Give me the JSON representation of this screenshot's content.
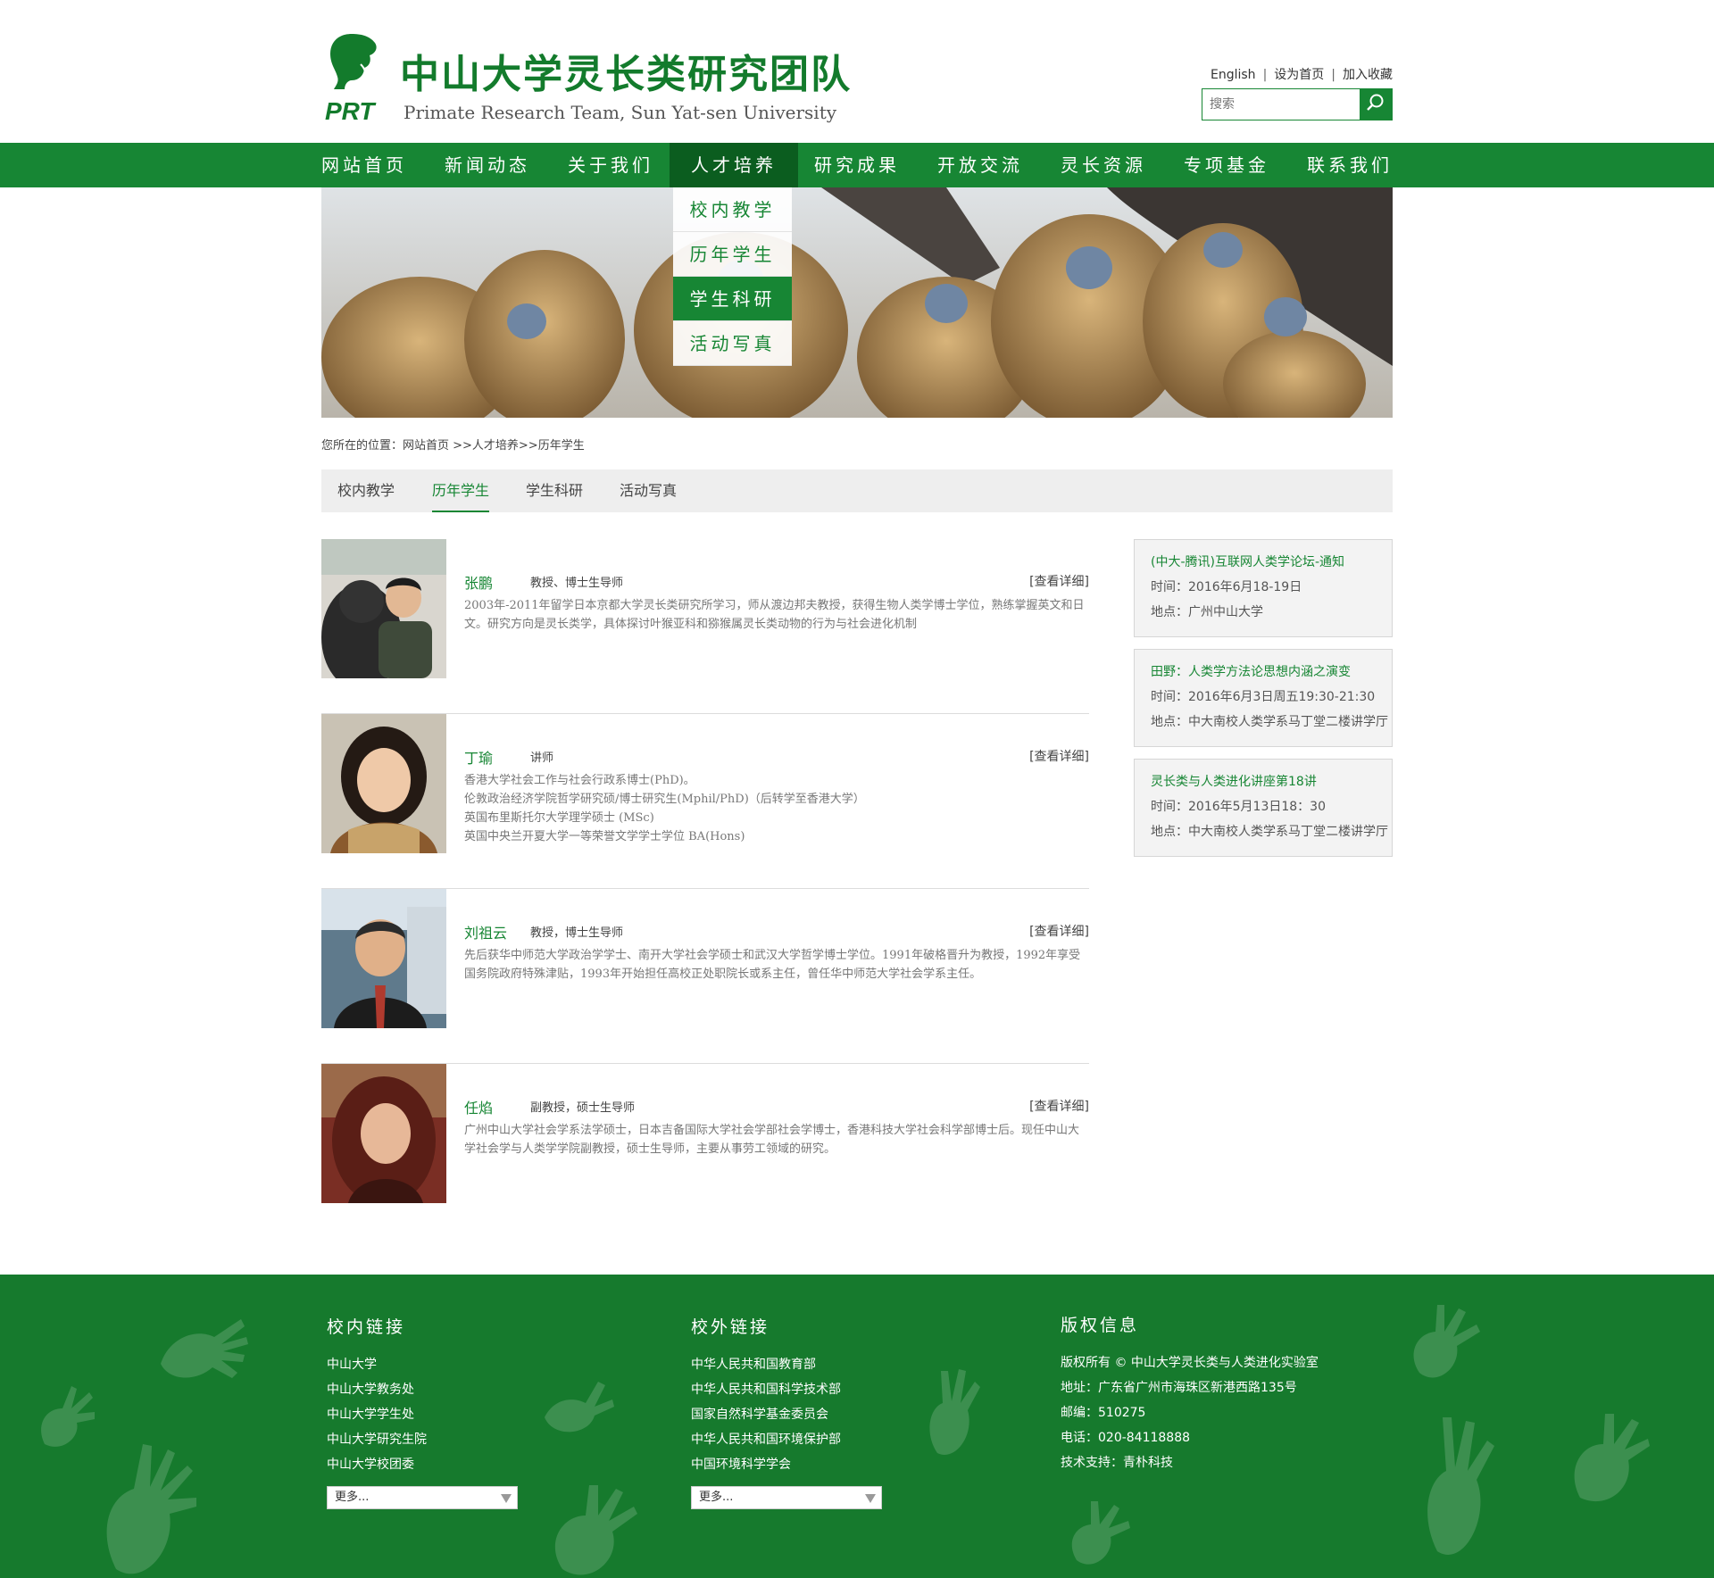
{
  "header": {
    "logo_text": "PRT",
    "title": "中山大学灵长类研究团队",
    "subtitle": "Primate Research Team, Sun Yat-sen University",
    "links": [
      "English",
      "设为首页",
      "加入收藏"
    ],
    "search_placeholder": "搜索",
    "search_icon": "search-icon"
  },
  "nav": {
    "items": [
      "网站首页",
      "新闻动态",
      "关于我们",
      "人才培养",
      "研究成果",
      "开放交流",
      "灵长资源",
      "专项基金",
      "联系我们"
    ],
    "active_index": 3,
    "dropdown": [
      "校内教学",
      "历年学生",
      "学生科研",
      "活动写真"
    ],
    "dropdown_active_index": 2
  },
  "breadcrumb": "您所在的位置：网站首页 >>人才培养>>历年学生",
  "tabs": {
    "items": [
      "校内教学",
      "历年学生",
      "学生科研",
      "活动写真"
    ],
    "active_index": 1
  },
  "people": [
    {
      "name": "张鹏",
      "title": "教授、博士生导师",
      "more": "[查看详细]",
      "desc": "2003年-2011年留学日本京都大学灵长类研究所学习，师从渡边邦夫教授，获得生物人类学博士学位，熟练掌握英文和日文。研究方向是灵长类学，具体探讨叶猴亚科和猕猴属灵长类动物的行为与社会进化机制"
    },
    {
      "name": "丁瑜",
      "title": "讲师",
      "more": "[查看详细]",
      "desc_lines": [
        "香港大学社会工作与社会行政系博士(PhD)。",
        "伦敦政治经济学院哲学研究硕/博士研究生(Mphil/PhD)（后转学至香港大学）",
        "英国布里斯托尔大学理学硕士 (MSc)",
        "英国中央兰开夏大学一等荣誉文学学士学位 BA(Hons)"
      ]
    },
    {
      "name": "刘祖云",
      "title": "教授，博士生导师",
      "more": "[查看详细]",
      "desc": "先后获华中师范大学政治学学士、南开大学社会学硕士和武汉大学哲学博士学位。1991年破格晋升为教授，1992年享受国务院政府特殊津贴，1993年开始担任高校正处职院长或系主任，曾任华中师范大学社会学系主任。"
    },
    {
      "name": "任焰",
      "title": "副教授，硕士生导师",
      "more": "[查看详细]",
      "desc": "广州中山大学社会学系法学硕士，日本吉备国际大学社会学部社会学博士，香港科技大学社会科学部博士后。现任中山大学社会学与人类学学院副教授，硕士生导师，主要从事劳工领域的研究。"
    }
  ],
  "events": [
    {
      "title": "(中大-腾讯)互联网人类学论坛-通知",
      "time": "时间：2016年6月18-19日",
      "place": "地点：广州中山大学"
    },
    {
      "title": "田野：人类学方法论思想内涵之演变",
      "time": "时间：2016年6月3日周五19:30-21:30",
      "place": "地点：中大南校人类学系马丁堂二楼讲学厅"
    },
    {
      "title": "灵长类与人类进化讲座第18讲",
      "time": "时间：2016年5月13日18：30",
      "place": "地点：中大南校人类学系马丁堂二楼讲学厅"
    }
  ],
  "footer": {
    "internal": {
      "heading": "校内链接",
      "links": [
        "中山大学",
        "中山大学教务处",
        "中山大学学生处",
        "中山大学研究生院",
        "中山大学校团委"
      ],
      "select": "更多..."
    },
    "external": {
      "heading": "校外链接",
      "links": [
        "中华人民共和国教育部",
        "中华人民共和国科学技术部",
        "国家自然科学基金委员会",
        "中华人民共和国环境保护部",
        "中国环境科学学会"
      ],
      "select": "更多..."
    },
    "copyright": {
      "heading": "版权信息",
      "lines": [
        "版权所有 © 中山大学灵长类与人类进化实验室",
        "地址：广东省广州市海珠区新港西路135号",
        "邮编：510275",
        "电话：020-84118888",
        "技术支持：青朴科技"
      ]
    }
  },
  "colors": {
    "brand_green": "#178634",
    "nav_active": "#0b5d1f",
    "footer_bg": "#167a2d"
  }
}
